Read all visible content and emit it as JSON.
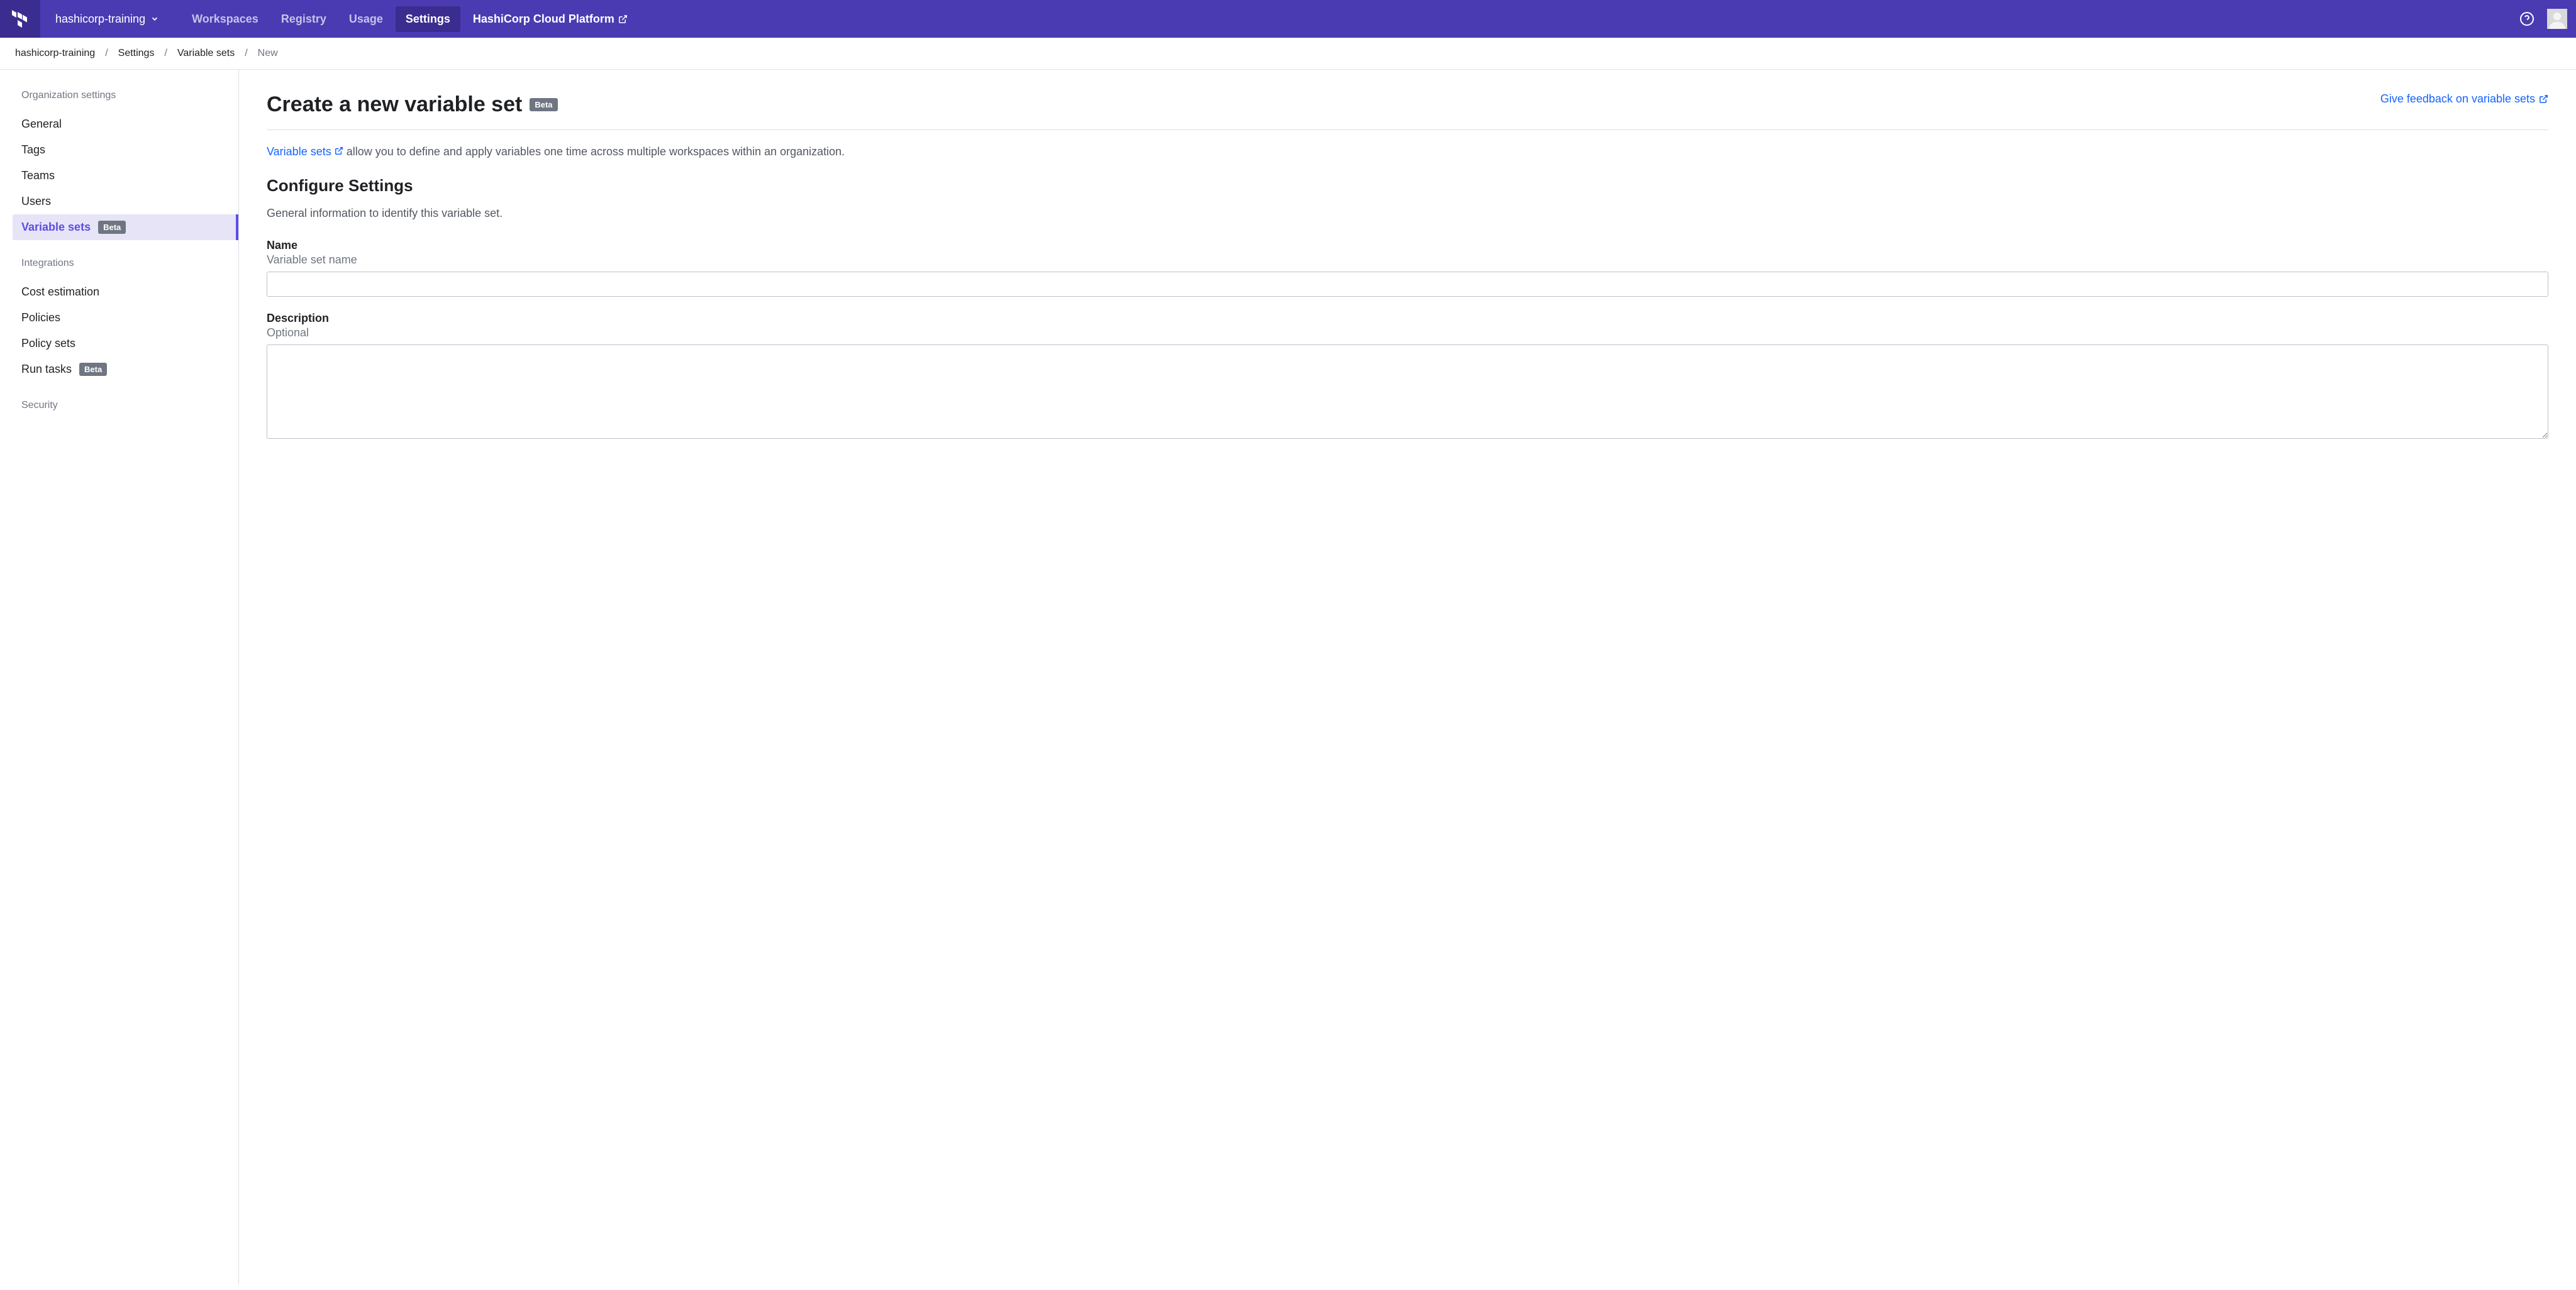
{
  "header": {
    "org_name": "hashicorp-training",
    "nav": {
      "workspaces": "Workspaces",
      "registry": "Registry",
      "usage": "Usage",
      "settings": "Settings",
      "hcp": "HashiCorp Cloud Platform"
    }
  },
  "breadcrumb": {
    "org": "hashicorp-training",
    "settings": "Settings",
    "varsets": "Variable sets",
    "current": "New"
  },
  "sidebar": {
    "org_section": "Organization settings",
    "items": {
      "general": "General",
      "tags": "Tags",
      "teams": "Teams",
      "users": "Users",
      "varsets": "Variable sets"
    },
    "integrations_section": "Integrations",
    "int_items": {
      "cost": "Cost estimation",
      "policies": "Policies",
      "policy_sets": "Policy sets",
      "run_tasks": "Run tasks"
    },
    "security_section": "Security",
    "beta_label": "Beta"
  },
  "main": {
    "title": "Create a new variable set",
    "title_badge": "Beta",
    "feedback": "Give feedback on variable sets",
    "intro_link": "Variable sets",
    "intro_rest": " allow you to define and apply variables one time across multiple workspaces within an organization.",
    "configure_title": "Configure Settings",
    "configure_desc": "General information to identify this variable set.",
    "name_label": "Name",
    "name_hint": "Variable set name",
    "desc_label": "Description",
    "desc_hint": "Optional"
  }
}
